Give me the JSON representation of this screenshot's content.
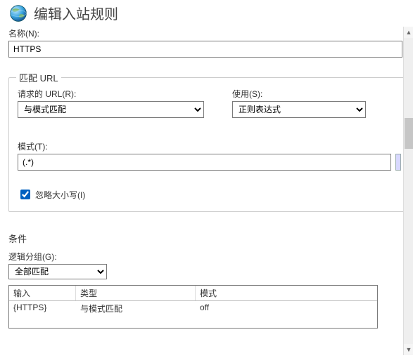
{
  "title": "编辑入站规则",
  "name": {
    "label": "名称(N):",
    "value": "HTTPS"
  },
  "matchUrl": {
    "legend": "匹配 URL",
    "requestedUrl": {
      "label": "请求的 URL(R):",
      "value": "与模式匹配"
    },
    "using": {
      "label": "使用(S):",
      "value": "正则表达式"
    },
    "pattern": {
      "label": "模式(T):",
      "value": "(.*)"
    },
    "ignoreCase": {
      "label": "忽略大小写(I)",
      "checked": true
    }
  },
  "conditions": {
    "heading": "条件",
    "grouping": {
      "label": "逻辑分组(G):",
      "value": "全部匹配"
    },
    "columns": {
      "input": "输入",
      "type": "类型",
      "mode": "模式"
    },
    "rows": [
      {
        "input": "{HTTPS}",
        "type": "与模式匹配",
        "mode": "off"
      }
    ]
  }
}
